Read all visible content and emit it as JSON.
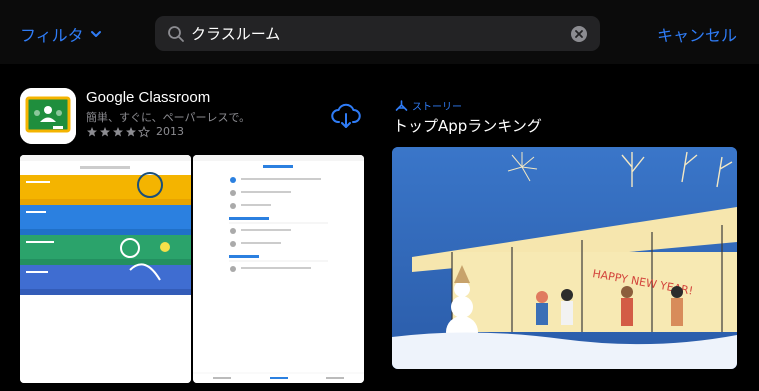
{
  "topbar": {
    "filter_label": "フィルタ",
    "search_value": "クラスルーム",
    "cancel_label": "キャンセル"
  },
  "app": {
    "name": "Google Classroom",
    "subtitle": "簡単、すぐに、ペーパーレスで。",
    "stars": 4,
    "rating_count": "2013"
  },
  "story": {
    "tag": "ストーリー",
    "title": "トップAppランキング"
  },
  "colors": {
    "accent": "#2f7cf6",
    "background": "#000000",
    "secondary_text": "#8c8c91"
  },
  "icons": [
    "chevron-down-icon",
    "search-icon",
    "clear-icon",
    "cloud-download-icon",
    "star-icon",
    "story-icon"
  ]
}
